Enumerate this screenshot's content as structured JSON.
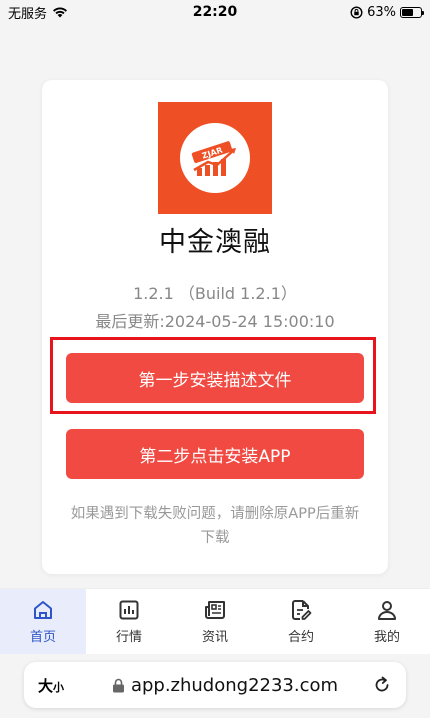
{
  "status_bar": {
    "carrier": "无服务",
    "time": "22:20",
    "battery_percent": "63%",
    "battery_level": 0.63
  },
  "app": {
    "icon_text": "ZJAR",
    "name": "中金澳融",
    "version": "1.2.1 （Build 1.2.1）",
    "updated": "最后更新:2024-05-24 15:00:10"
  },
  "buttons": {
    "step1": "第一步安装描述文件",
    "step2": "第二步点击安装APP"
  },
  "hint": "如果遇到下载失败问题，请删除原APP后重新下载",
  "tabs": [
    {
      "label": "首页",
      "icon": "home-icon",
      "active": true
    },
    {
      "label": "行情",
      "icon": "chart-icon",
      "active": false
    },
    {
      "label": "资讯",
      "icon": "news-icon",
      "active": false
    },
    {
      "label": "合约",
      "icon": "contract-icon",
      "active": false
    },
    {
      "label": "我的",
      "icon": "user-icon",
      "active": false
    }
  ],
  "browser": {
    "text_size_big": "大",
    "text_size_small": "小",
    "url": "app.zhudong2233.com"
  },
  "colors": {
    "brand_orange": "#ef4f24",
    "button_red": "#f04a43",
    "highlight_red": "#e8141b",
    "tab_active": "#2f56c8"
  }
}
